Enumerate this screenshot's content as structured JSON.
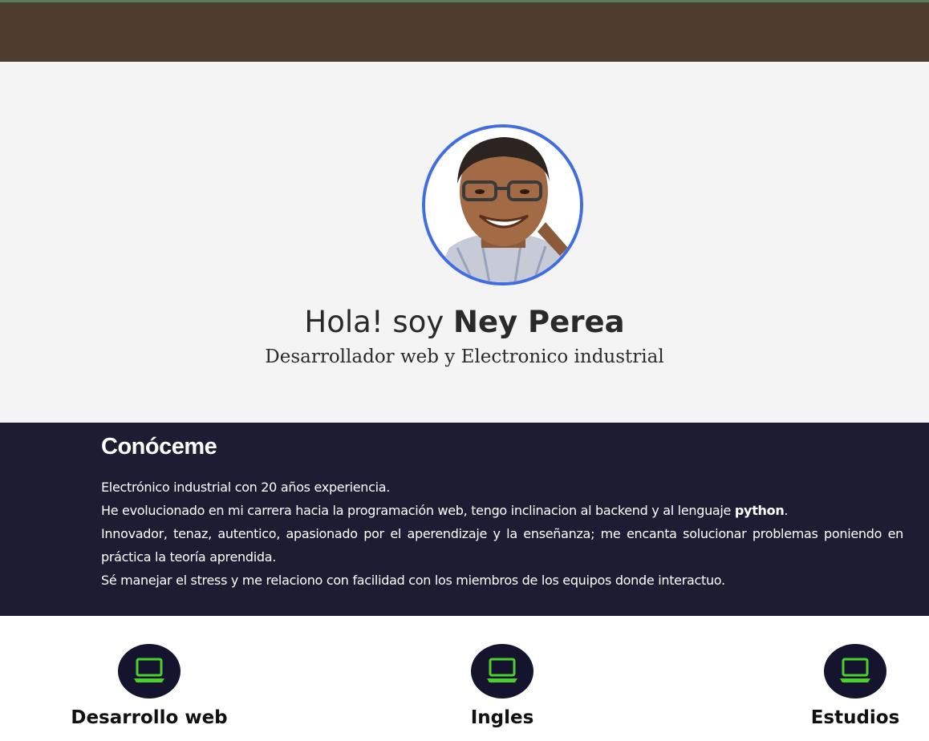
{
  "hero": {
    "greeting": "Hola! soy",
    "name": "Ney Perea",
    "subtitle": "Desarrollador web y Electronico industrial"
  },
  "about": {
    "title": "Conóceme",
    "line1": "Electrónico industrial con 20 años experiencia.",
    "line2_pre": "He evolucionado en mi carrera hacia la programación web, tengo inclinacion al backend y al lenguaje ",
    "line2_bold": "python",
    "line2_post": ".",
    "line3": "Innovador, tenaz, autentico, apasionado por el aperendizaje y la enseñanza; me encanta solucionar problemas poniendo en práctica la teoría aprendida.",
    "line4": "Sé manejar el stress y me relaciono con facilidad con los miembros de los equipos donde interactuo."
  },
  "skills": [
    {
      "label": "Desarrollo web",
      "icon": "laptop-icon"
    },
    {
      "label": "Ingles",
      "icon": "laptop-icon"
    },
    {
      "label": "Estudios",
      "icon": "laptop-icon"
    }
  ],
  "colors": {
    "navbar": "#4e3d2e",
    "hero_bg": "#f4f4f4",
    "avatar_border": "#3f6ee0",
    "about_bg": "#1c1d33",
    "icon_circle": "#14142e",
    "icon_green": "#4ccf2e"
  }
}
